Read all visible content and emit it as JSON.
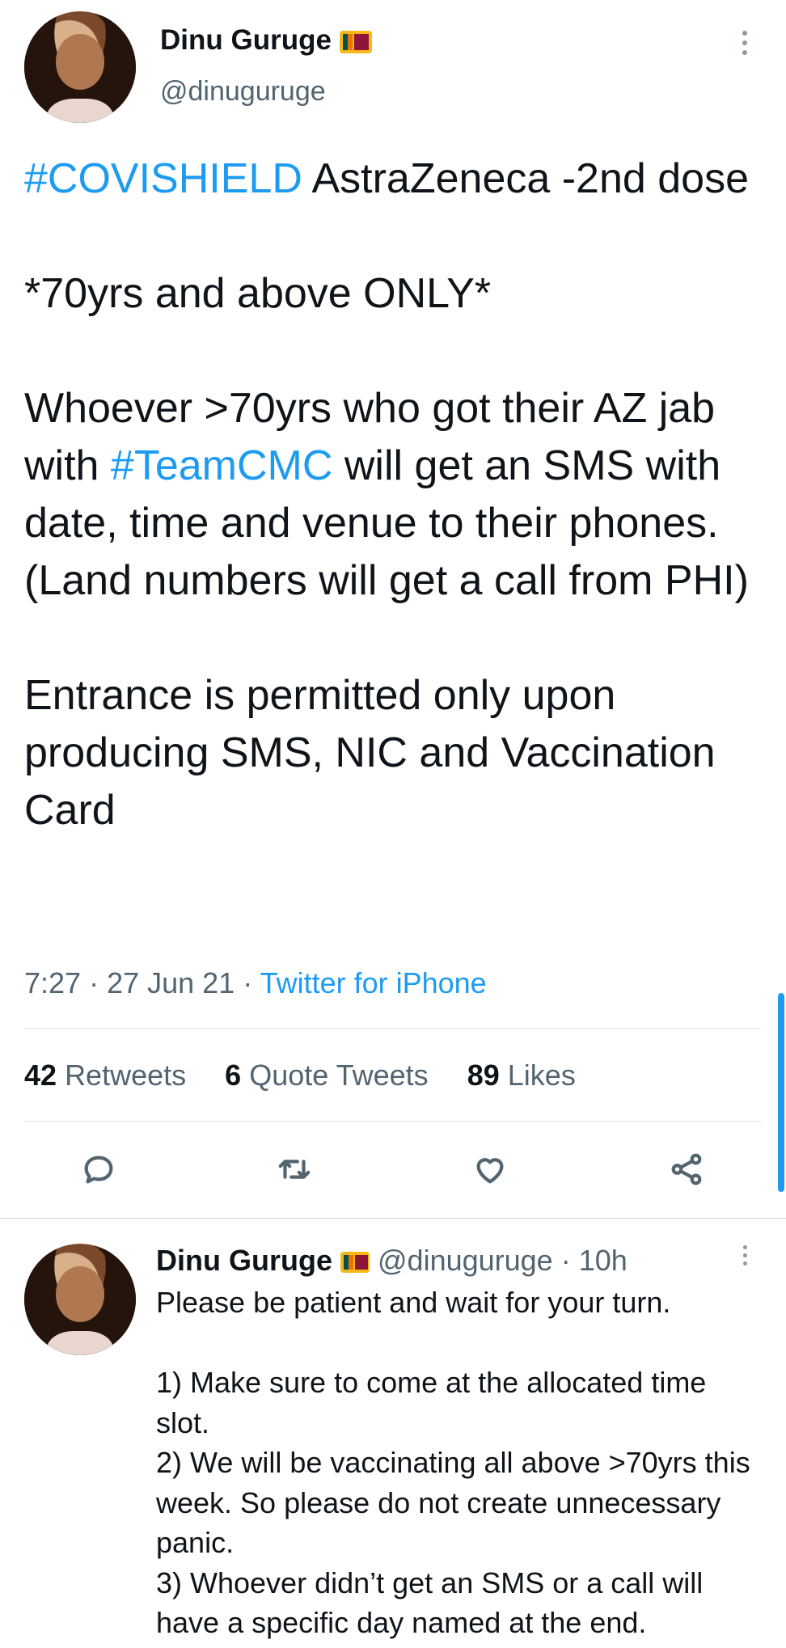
{
  "tweet": {
    "author_name": "Dinu Guruge",
    "handle": "@dinuguruge",
    "hashtag_covishield": "#COVISHIELD",
    "line1_rest": " AstraZeneca -2nd dose",
    "line2": "*70yrs and above ONLY*",
    "para3_a": "Whoever >70yrs who got their AZ jab with ",
    "hashtag_teamcmc": "#TeamCMC",
    "para3_b": " will get an SMS with date, time and venue to their phones.(Land numbers will get a call from PHI)",
    "para4": "Entrance is permitted only upon producing SMS, NIC and Vaccination Card",
    "time": "7:27",
    "date": "27 Jun 21",
    "source": "Twitter for iPhone",
    "retweets_count": "42",
    "retweets_label": "Retweets",
    "quotes_count": "6",
    "quotes_label": "Quote Tweets",
    "likes_count": "89",
    "likes_label": "Likes"
  },
  "reply": {
    "author_name": "Dinu Guruge",
    "handle": "@dinuguruge",
    "time": "10h",
    "line1": "Please be patient and wait for your turn.",
    "item1": "1) Make sure to come at the allocated time slot.",
    "item2": "2) We will be vaccinating all above >70yrs this week. So please do not create unnecessary panic.",
    "item3": "3) Whoever didn’t get an SMS or a call will have a specific day named at the end."
  },
  "icons": {
    "reply": "reply-icon",
    "retweet": "retweet-icon",
    "like": "heart-icon",
    "share": "share-icon",
    "more": "more-options-icon",
    "flag": "sri-lanka-flag-icon"
  },
  "colors": {
    "accent": "#1d9bf0",
    "text": "#0f1419",
    "muted": "#536471"
  }
}
